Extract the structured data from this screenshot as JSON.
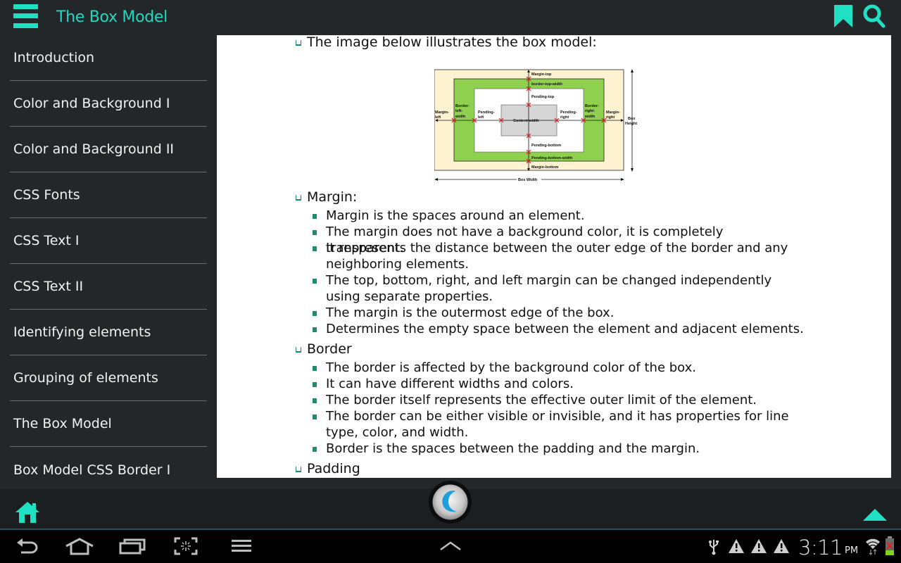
{
  "app": {
    "title": "The Box Model",
    "accent_color": "#1fe0c2"
  },
  "header": {
    "menu_icon": "hamburger-menu-icon",
    "bookmark_icon": "bookmark-icon",
    "search_icon": "search-icon"
  },
  "sidebar": {
    "items": [
      {
        "label": "Introduction"
      },
      {
        "label": "Color and Background I"
      },
      {
        "label": "Color and Background II"
      },
      {
        "label": "CSS Fonts"
      },
      {
        "label": "CSS Text I"
      },
      {
        "label": "CSS Text II"
      },
      {
        "label": "Identifying elements"
      },
      {
        "label": "Grouping of elements"
      },
      {
        "label": "The Box Model"
      },
      {
        "label": "Box Model CSS Border I"
      }
    ]
  },
  "content": {
    "intro": "The image below illustrates the box model:",
    "diagram": {
      "margin_top": "Margin-top",
      "border_top_width": "border-top-width",
      "padding_top": "Pending-top",
      "border_left_width_1": "Border-",
      "border_left_width_2": "left-",
      "border_left_width_3": "width",
      "margin_left_1": "Margin-",
      "margin_left_2": "left",
      "padding_left_1": "Pending-",
      "padding_left_2": "left",
      "content_width": "Content width",
      "padding_right_1": "Pending-",
      "padding_right_2": "right",
      "border_right_width_1": "Border-",
      "border_right_width_2": "right-",
      "border_right_width_3": "width",
      "margin_right_1": "Margin-",
      "margin_right_2": "right",
      "box_height_1": "Box",
      "box_height_2": "Height",
      "padding_bottom": "Pending-bottom",
      "border_bottom_width": "Pending-bottom-width",
      "margin_bottom": "Margin-bottom",
      "box_width": "Box Width"
    },
    "sections": [
      {
        "heading": "Margin:",
        "points": [
          "Margin is the spaces around an element.",
          "The margin does not have a background color, it is completely transparent.",
          "It represents the distance between the outer edge of the border and any neighboring elements.",
          "The top, bottom, right, and left margin can be changed independently using separate properties.",
          "The margin is the outermost edge of the box.",
          "Determines the empty space between the element and adjacent elements."
        ]
      },
      {
        "heading": "Border",
        "points": [
          "The border is affected by the background color of the box.",
          "It can have different widths and colors.",
          "The border itself represents the effective outer limit of the element.",
          "The border can be either visible or invisible, and it has properties for line type, color, and width.",
          "Border is the spaces between the padding and the margin."
        ]
      },
      {
        "heading": "Padding",
        "points": []
      }
    ]
  },
  "bottom_bar": {
    "home_icon": "home-icon",
    "center_icon": "app-logo-icon",
    "up_icon": "scroll-up-icon"
  },
  "system_bar": {
    "time": "3:11",
    "ampm": "PM",
    "nav": [
      "back-icon",
      "home-icon",
      "recent-apps-icon",
      "screenshot-icon",
      "menu-icon",
      "expand-icon"
    ],
    "status_icons": [
      "usb-icon",
      "warning-icon",
      "warning-icon",
      "warning-icon",
      "wifi-icon",
      "battery-icon"
    ]
  }
}
